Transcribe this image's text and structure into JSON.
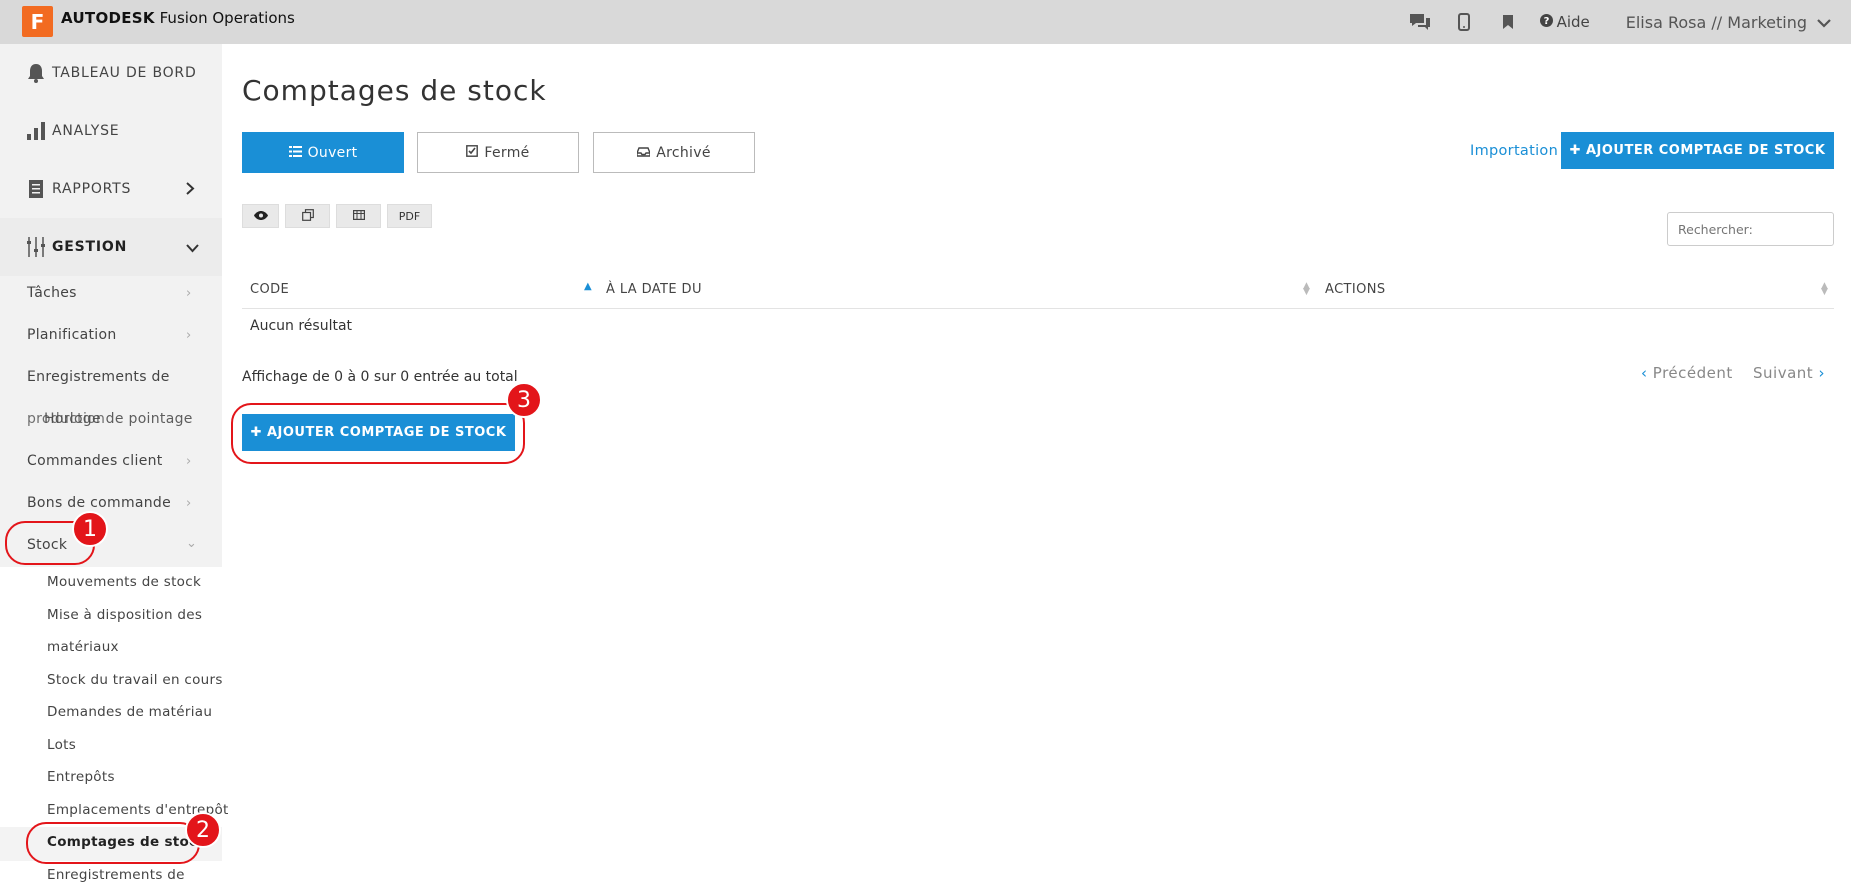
{
  "app": {
    "logo_letter": "F",
    "brand": "AUTODESK",
    "product": "Fusion Operations"
  },
  "topbar": {
    "help_label": "Aide",
    "user_label": "Elisa Rosa // Marketing"
  },
  "sidebar": {
    "main": [
      {
        "label": "TABLEAU DE BORD"
      },
      {
        "label": "ANALYSE"
      },
      {
        "label": "RAPPORTS"
      },
      {
        "label": "GESTION"
      }
    ],
    "sub": [
      {
        "label": "Tâches"
      },
      {
        "label": "Planification"
      },
      {
        "label": "Enregistrements de"
      },
      {
        "label": "production"
      },
      {
        "label": "Horloge de pointage"
      },
      {
        "label": "Commandes client"
      },
      {
        "label": "Bons de commande"
      },
      {
        "label": "Stock"
      }
    ],
    "stock_items": [
      {
        "label": "Mouvements de stock"
      },
      {
        "label": "Mise à disposition des"
      },
      {
        "label": "matériaux"
      },
      {
        "label": "Stock du travail en cours"
      },
      {
        "label": "Demandes de matériau"
      },
      {
        "label": "Lots"
      },
      {
        "label": "Entrepôts"
      },
      {
        "label": "Emplacements d'entrepôt"
      },
      {
        "label": "Comptages de stock"
      },
      {
        "label": "Enregistrements de"
      }
    ]
  },
  "main": {
    "title": "Comptages de stock",
    "tabs": [
      {
        "label": "Ouvert",
        "icon": "list-icon"
      },
      {
        "label": "Fermé",
        "icon": "checked-square-icon"
      },
      {
        "label": "Archivé",
        "icon": "inbox-icon"
      }
    ],
    "import_label": "Importation",
    "add_label": "✚ AJOUTER COMPTAGE DE STOCK",
    "tools": {
      "pdf": "PDF"
    },
    "search_placeholder": "Rechercher:",
    "table": {
      "headers": [
        "CODE",
        "À LA DATE DU",
        "ACTIONS"
      ],
      "empty": "Aucun résultat"
    },
    "info": "Affichage de 0 à 0 sur 0 entrée au total",
    "pager": {
      "prev": "Précédent",
      "next": "Suivant"
    }
  },
  "annotations": {
    "badges": [
      "1",
      "2",
      "3"
    ]
  },
  "colors": {
    "accent": "#1a8fd6",
    "annotation": "#e3151a",
    "logo": "#f26b21"
  }
}
